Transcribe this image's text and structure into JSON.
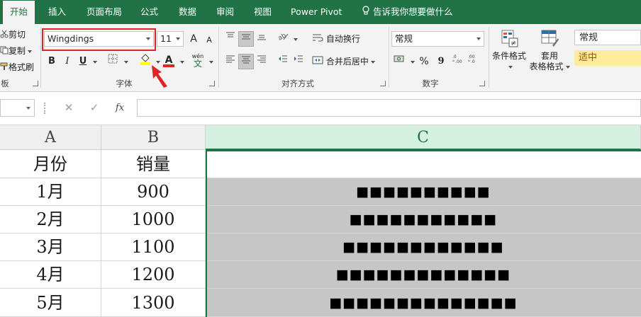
{
  "tabs": [
    "开始",
    "插入",
    "页面布局",
    "公式",
    "数据",
    "审阅",
    "视图",
    "Power Pivot",
    "告诉我你想要做什么"
  ],
  "clipboard": {
    "cut": "剪切",
    "copy": "复制",
    "format_painter": "格式刷",
    "group_label": "板"
  },
  "font": {
    "name": "Wingdings",
    "size": "11",
    "grow": "A",
    "shrink": "A",
    "bold": "B",
    "italic": "I",
    "underline": "U",
    "font_color_letter": "A",
    "phonetic_top": "wén",
    "phonetic_bottom": "文",
    "group_label": "字体",
    "fill_color": "#ffff00",
    "font_color": "#e02424"
  },
  "alignment": {
    "wrap_text": "自动换行",
    "merge_center": "合并后居中",
    "group_label": "对齐方式"
  },
  "number": {
    "format": "常规",
    "percent": "%",
    "comma": "9",
    "group_label": "数字"
  },
  "styles": {
    "conditional_line1": "条件格式",
    "table_line1": "套用",
    "table_line2": "表格格式",
    "normal": "常规",
    "neutral": "适中",
    "neutral_bg": "#ffeb9c",
    "neutral_color": "#9c5700"
  },
  "formula_bar": {
    "cancel": "✕",
    "enter": "✓",
    "fx": "fx",
    "value": ""
  },
  "columns": [
    "A",
    "B",
    "C"
  ],
  "rows": [
    {
      "a": "月份",
      "b": "销量",
      "c": ""
    },
    {
      "a": "1月",
      "b": "900",
      "c": "■■■■■■■■■■"
    },
    {
      "a": "2月",
      "b": "1000",
      "c": "■■■■■■■■■■■"
    },
    {
      "a": "3月",
      "b": "1100",
      "c": "■■■■■■■■■■■■"
    },
    {
      "a": "4月",
      "b": "1200",
      "c": "■■■■■■■■■■■■■"
    },
    {
      "a": "5月",
      "b": "1300",
      "c": "■■■■■■■■■■■■■■"
    }
  ],
  "colors": {
    "accent": "#217346",
    "highlight_box": "#e02424",
    "cell_fill": "#c6c6c6"
  }
}
